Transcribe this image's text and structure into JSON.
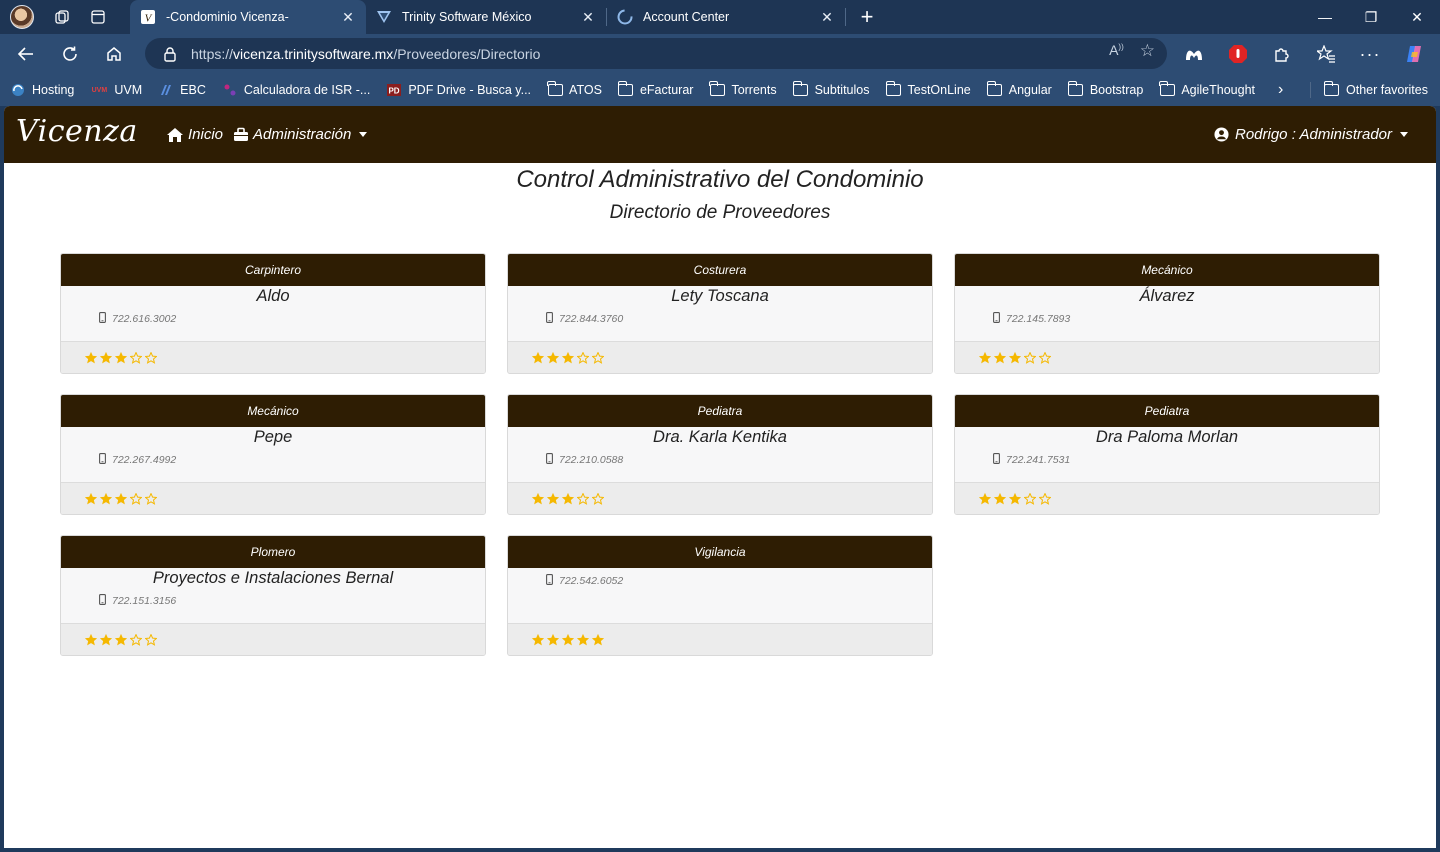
{
  "browser": {
    "tabs": [
      {
        "title": "-Condominio Vicenza-",
        "active": true,
        "favicon": "vicenza-favicon"
      },
      {
        "title": "Trinity Software México",
        "active": false,
        "favicon": "trinity-favicon"
      },
      {
        "title": "Account Center",
        "active": false,
        "favicon": "account-center-favicon"
      }
    ],
    "url_prefix": "https://",
    "url_host": "vicenza.trinitysoftware.mx",
    "url_path": "/Proveedores/Directorio",
    "bookmarks": [
      {
        "label": "Hosting",
        "icon": "hosting-icon"
      },
      {
        "label": "UVM",
        "icon": "uvm-icon"
      },
      {
        "label": "EBC",
        "icon": "ebc-icon"
      },
      {
        "label": "Calculadora de ISR -...",
        "icon": "calculator-icon"
      },
      {
        "label": "PDF Drive - Busca y...",
        "icon": "pdf-icon"
      },
      {
        "label": "ATOS",
        "icon": "folder-icon"
      },
      {
        "label": "eFacturar",
        "icon": "folder-icon"
      },
      {
        "label": "Torrents",
        "icon": "folder-icon"
      },
      {
        "label": "Subtitulos",
        "icon": "folder-icon"
      },
      {
        "label": "TestOnLine",
        "icon": "folder-icon"
      },
      {
        "label": "Angular",
        "icon": "folder-icon"
      },
      {
        "label": "Bootstrap",
        "icon": "folder-icon"
      },
      {
        "label": "AgileThought",
        "icon": "folder-icon"
      }
    ],
    "other_favorites": "Other favorites"
  },
  "app": {
    "brand": "Vicenza",
    "nav": {
      "home": "Inicio",
      "admin": "Administración",
      "user": "Rodrigo : Administrador"
    },
    "title": "Control Administrativo del Condominio",
    "subtitle": "Directorio de Proveedores",
    "star_color": "#f5b800",
    "header_color": "#2e1d03"
  },
  "providers": [
    {
      "category": "Carpintero",
      "name": "Aldo",
      "phone": "722.616.3002",
      "rating": 3
    },
    {
      "category": "Costurera",
      "name": "Lety Toscana",
      "phone": "722.844.3760",
      "rating": 3
    },
    {
      "category": "Mecánico",
      "name": "Álvarez",
      "phone": "722.145.7893",
      "rating": 3
    },
    {
      "category": "Mecánico",
      "name": "Pepe",
      "phone": "722.267.4992",
      "rating": 3
    },
    {
      "category": "Pediatra",
      "name": "Dra. Karla Kentika",
      "phone": "722.210.0588",
      "rating": 3
    },
    {
      "category": "Pediatra",
      "name": "Dra Paloma Morlan",
      "phone": "722.241.7531",
      "rating": 3
    },
    {
      "category": "Plomero",
      "name": "Proyectos e Instalaciones Bernal",
      "phone": "722.151.3156",
      "rating": 3
    },
    {
      "category": "Vigilancia",
      "name": "",
      "phone": "722.542.6052",
      "rating": 5
    }
  ]
}
